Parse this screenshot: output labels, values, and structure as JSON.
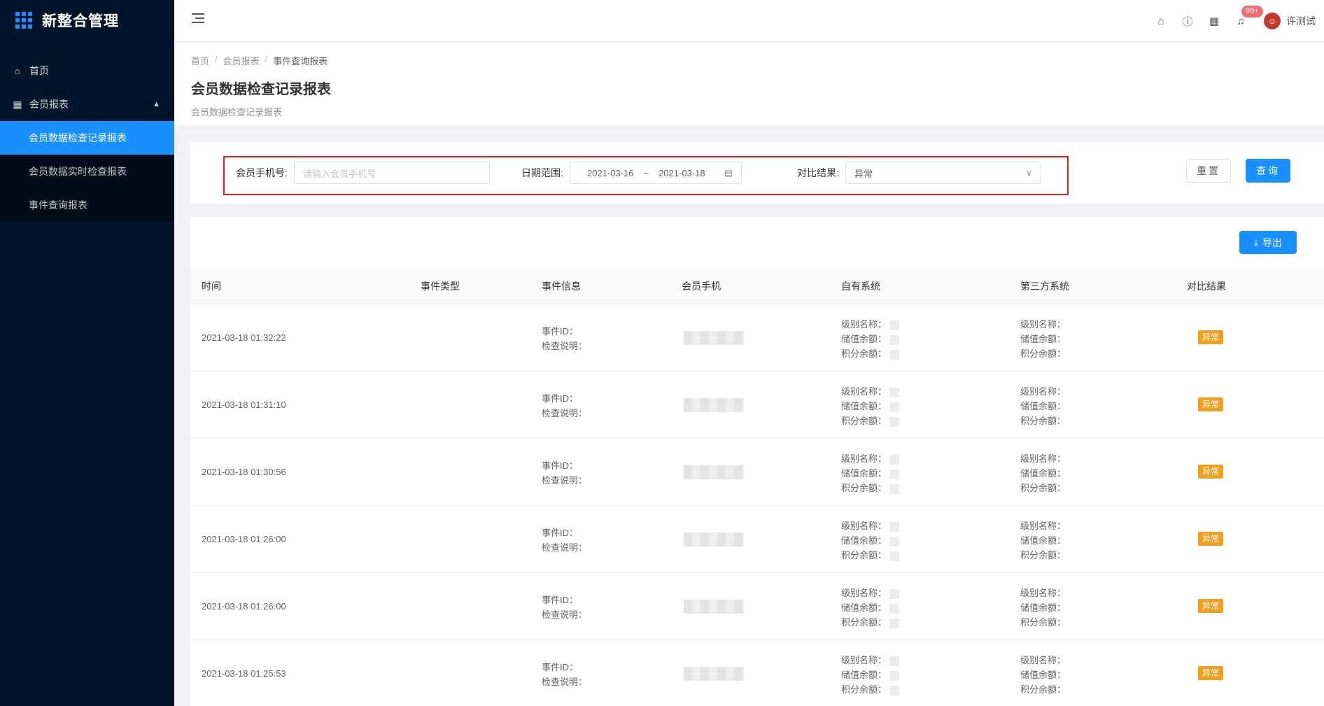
{
  "app": {
    "title": "新整合管理"
  },
  "sidebar": {
    "home": "首页",
    "group": "会员报表",
    "items": [
      "会员数据检查记录报表",
      "会员数据实时检查报表",
      "事件查询报表"
    ]
  },
  "header": {
    "badge": "99+",
    "username": "许测试"
  },
  "breadcrumb": [
    "首页",
    "会员报表",
    "事件查询报表"
  ],
  "page": {
    "title": "会员数据检查记录报表",
    "subtitle": "会员数据检查记录报表"
  },
  "filter": {
    "phone_label": "会员手机号:",
    "phone_placeholder": "请输入会员手机号",
    "date_label": "日期范围:",
    "date_start": "2021-03-16",
    "date_sep": "~",
    "date_end": "2021-03-18",
    "result_label": "对比结果:",
    "result_value": "异常",
    "reset": "重置",
    "query": "查询"
  },
  "table": {
    "export": "导出",
    "columns": [
      "时间",
      "事件类型",
      "事件信息",
      "会员手机",
      "自有系统",
      "第三方系统",
      "对比结果"
    ],
    "labels": {
      "event_id": "事件ID：",
      "check_note": "检查说明：",
      "level": "级别名称：",
      "stored": "储值余额：",
      "points": "积分余额："
    },
    "rows": [
      {
        "time": "2021-03-18 01:32:22",
        "result": "异常"
      },
      {
        "time": "2021-03-18 01:31:10",
        "result": "异常"
      },
      {
        "time": "2021-03-18 01:30:56",
        "result": "异常"
      },
      {
        "time": "2021-03-18 01:26:00",
        "result": "异常"
      },
      {
        "time": "2021-03-18 01:26:00",
        "result": "异常"
      },
      {
        "time": "2021-03-18 01:25:53",
        "result": "异常"
      }
    ]
  }
}
